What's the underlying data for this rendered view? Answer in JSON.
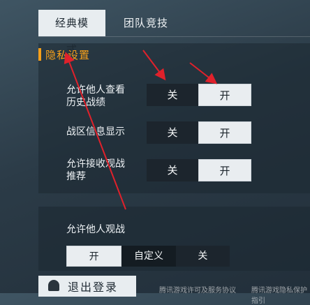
{
  "tabs": [
    {
      "label": "经典模式",
      "active": true
    },
    {
      "label": "团队竞技",
      "active": false
    }
  ],
  "section": {
    "title": "隐私设置",
    "accent_color": "#f6a01a"
  },
  "rows": [
    {
      "label_line1": "允许他人查看",
      "label_line2": "历史战绩",
      "off": "关",
      "on": "开",
      "selected": "开"
    },
    {
      "label_line1": "战区信息显示",
      "label_line2": "",
      "off": "关",
      "on": "开",
      "selected": "开"
    },
    {
      "label_line1": "允许接收观战",
      "label_line2": "推荐",
      "off": "关",
      "on": "开",
      "selected": "开"
    }
  ],
  "spectate": {
    "label": "允许他人观战",
    "options": [
      "开",
      "自定义",
      "关"
    ],
    "selected": "开"
  },
  "logout": {
    "label": "退出登录",
    "icon": "bell-icon"
  },
  "footer": {
    "left": "腾讯游戏许可及服务协议",
    "right": "腾讯游戏隐私保护指引"
  },
  "annotation_color": "#e0212b"
}
